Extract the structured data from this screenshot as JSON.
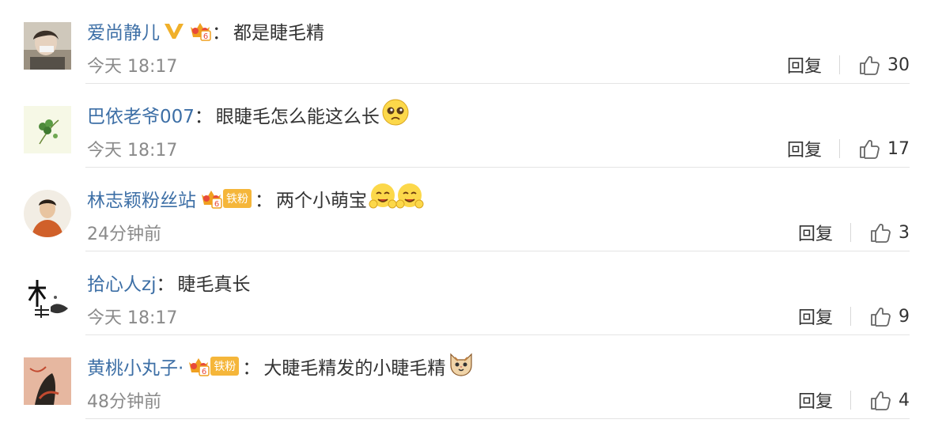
{
  "colors": {
    "username": "#3d6fa6",
    "text": "#333333",
    "meta": "#8a8a8a",
    "vip": "#f0b02a",
    "fan_badge": "#f5b63a"
  },
  "comments": [
    {
      "user": "爱尚静儿",
      "badges": [
        "v-icon",
        "crown-icon"
      ],
      "colon": "：",
      "text": "都是睫毛精",
      "time": "今天 18:17",
      "reply": "回复",
      "likes": "30"
    },
    {
      "user": "巴依老爷007",
      "badges": [],
      "colon": "：",
      "text": "眼睫毛怎么能这么长",
      "emoji": [
        "pleading-face"
      ],
      "time": "今天 18:17",
      "reply": "回复",
      "likes": "17"
    },
    {
      "user": "林志颖粉丝站",
      "badges": [
        "crown-icon",
        "fan-badge"
      ],
      "fan_label": "铁粉",
      "colon": "：",
      "text": "两个小萌宝",
      "emoji": [
        "hugging-face",
        "hugging-face"
      ],
      "time": "24分钟前",
      "reply": "回复",
      "likes": "3"
    },
    {
      "user": "拾心人zj",
      "badges": [],
      "colon": "：",
      "text": "睫毛真长",
      "time": "今天 18:17",
      "reply": "回复",
      "likes": "9"
    },
    {
      "user": "黄桃小丸子·",
      "badges": [
        "crown-icon",
        "fan-badge"
      ],
      "fan_label": "铁粉",
      "colon": "：",
      "text": "大睫毛精发的小睫毛精",
      "emoji": [
        "cat-face"
      ],
      "time": "48分钟前",
      "reply": "回复",
      "likes": "4"
    }
  ]
}
